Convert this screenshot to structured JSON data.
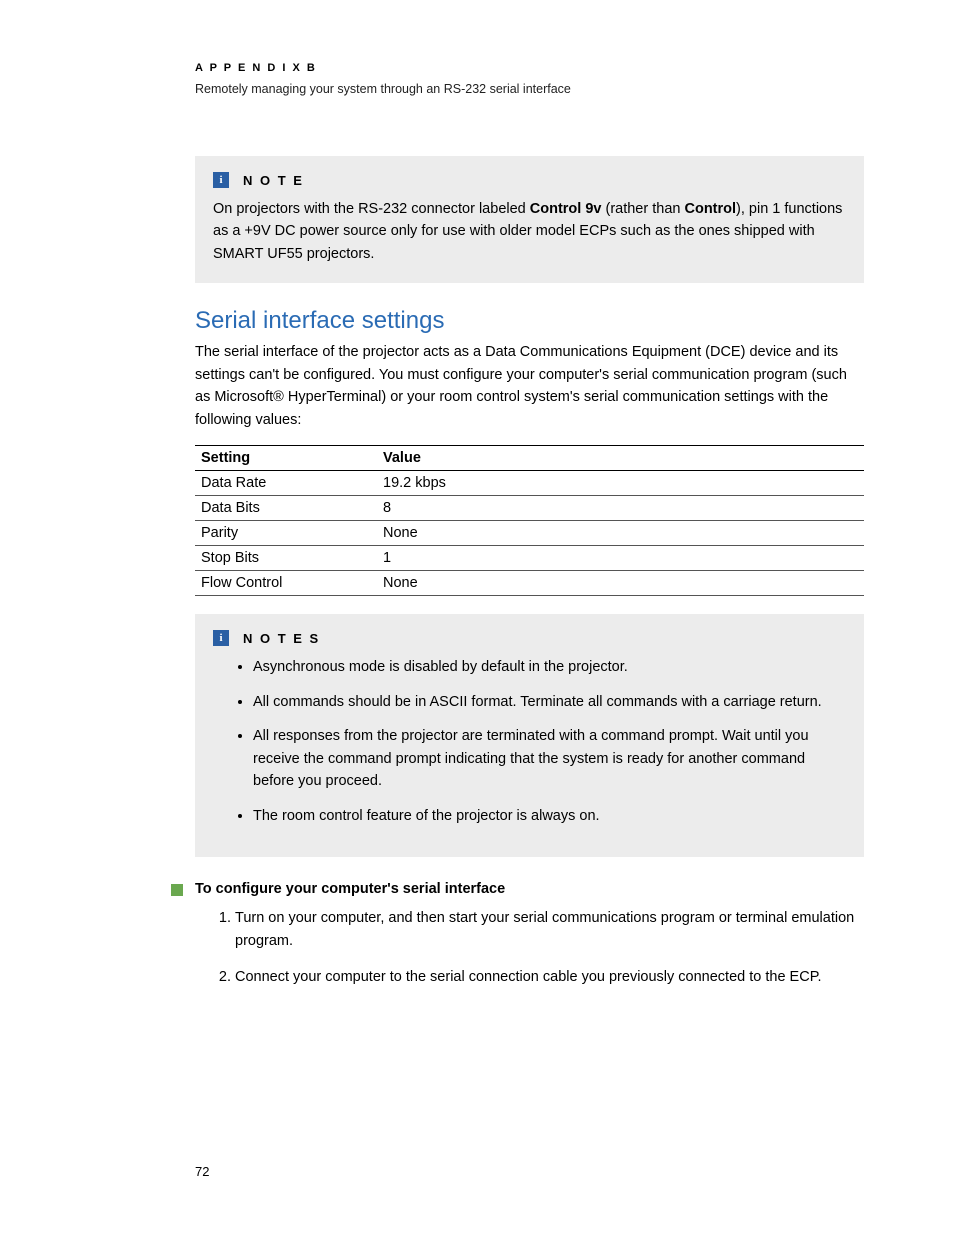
{
  "header": {
    "appendix": "A P P E N D I X   B",
    "subtitle": "Remotely managing your system through an RS-232 serial interface"
  },
  "note1": {
    "label": "N O T E",
    "pre": "On projectors with the RS-232 connector labeled ",
    "bold1": "Control 9v",
    "mid": " (rather than ",
    "bold2": "Control",
    "post": "), pin 1 functions as a +9V DC power source only for use with older model ECPs such as the ones shipped with SMART UF55 projectors."
  },
  "section": {
    "heading": "Serial interface settings",
    "body": "The serial interface of the projector acts as a Data Communications Equipment (DCE) device and its settings can't be configured. You must configure your computer's serial communication program (such as Microsoft® HyperTerminal) or your room control system's serial communication settings with the following values:"
  },
  "table": {
    "h1": "Setting",
    "h2": "Value",
    "rows": [
      {
        "s": "Data Rate",
        "v": "19.2 kbps"
      },
      {
        "s": "Data Bits",
        "v": "8"
      },
      {
        "s": "Parity",
        "v": "None"
      },
      {
        "s": "Stop Bits",
        "v": "1"
      },
      {
        "s": "Flow Control",
        "v": "None"
      }
    ]
  },
  "note2": {
    "label": "N O T E S",
    "items": [
      "Asynchronous mode is disabled by default in the projector.",
      "All commands should be in ASCII format. Terminate all commands with a carriage return.",
      "All responses from the projector are terminated with a command prompt. Wait until you receive the command prompt indicating that the system is ready for another command before you proceed.",
      "The room control feature of the projector is always on."
    ]
  },
  "procedure": {
    "title": "To configure your computer's serial interface",
    "steps": [
      "Turn on your computer, and then start your serial communications program or terminal emulation program.",
      "Connect your computer to the serial connection cable you previously connected to the ECP."
    ]
  },
  "pageNumber": "72"
}
